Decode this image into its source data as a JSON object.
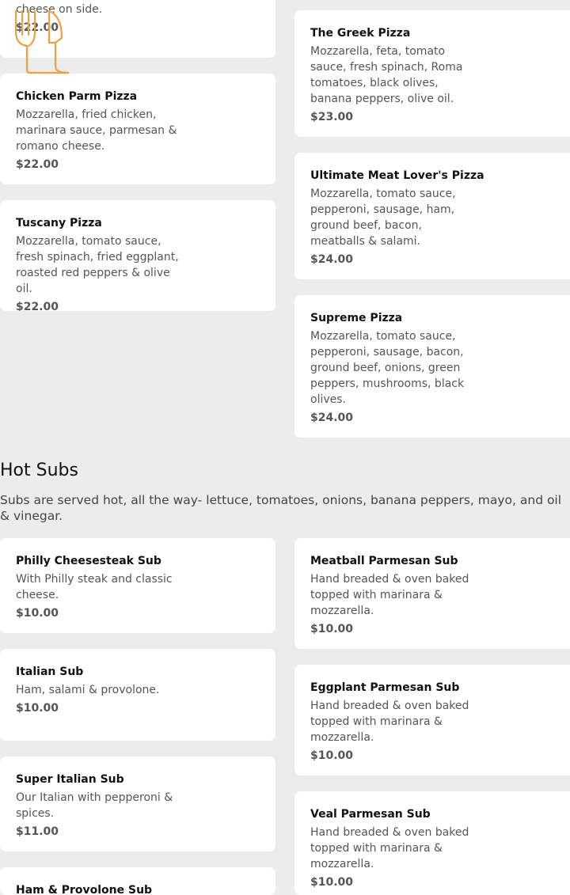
{
  "pizzas_left": [
    {
      "desc": "buffalo sauce, ranch or blue cheese on side.",
      "price": "$22.00"
    },
    {
      "name": "Chicken Parm Pizza",
      "desc": "Mozzarella, fried chicken, marinara sauce, parmesan & romano cheese.",
      "price": "$22.00"
    },
    {
      "name": "Tuscany Pizza",
      "desc": "Mozzarella, tomato sauce, fresh spinach, fried eggplant, roasted red peppers & olive oil.",
      "price": "$22.00"
    }
  ],
  "pizzas_right": [
    {
      "name": "The Greek Pizza",
      "desc": "Mozzarella, feta, tomato sauce, fresh spinach, Roma tomatoes, black olives, banana peppers, olive oil.",
      "price": "$23.00"
    },
    {
      "name": "Ultimate Meat Lover's Pizza",
      "desc": "Mozzarella, tomato sauce, pepperoni, sausage, ham, ground beef, bacon, meatballs & salami.",
      "price": "$24.00"
    },
    {
      "name": "Supreme Pizza",
      "desc": "Mozzarella, tomato sauce, pepperoni, sausage, bacon, ground beef, onions, green peppers, mushrooms, black olives.",
      "price": "$24.00"
    }
  ],
  "hot_subs": {
    "title": "Hot Subs",
    "description": "Subs are served hot, all the way- lettuce, tomatoes, onions, banana peppers, mayo, and oil & vinegar.",
    "left": [
      {
        "name": "Philly Cheesesteak Sub",
        "desc": "With Philly steak and classic cheese.",
        "price": "$10.00"
      },
      {
        "name": "Italian Sub",
        "desc": "Ham, salami & provolone.",
        "price": "$10.00"
      },
      {
        "name": "Super Italian Sub",
        "desc": "Our Italian with pepperoni & spices.",
        "price": "$11.00"
      },
      {
        "name": "Ham & Provolone Sub",
        "desc": "",
        "price": ""
      }
    ],
    "right": [
      {
        "name": "Meatball Parmesan Sub",
        "desc": "Hand breaded & oven baked topped with marinara & mozzarella.",
        "price": "$10.00"
      },
      {
        "name": "Eggplant Parmesan Sub",
        "desc": "Hand breaded & oven baked topped with marinara & mozzarella.",
        "price": "$10.00"
      },
      {
        "name": "Veal Parmesan Sub",
        "desc": "Hand breaded & oven baked topped with marinara & mozzarella.",
        "price": "$10.00"
      }
    ]
  },
  "colors": {
    "logo": "#f0a040",
    "card": "#ffffff",
    "background": "#ececec"
  },
  "icons": {
    "logo": "fork-knife-icon"
  }
}
